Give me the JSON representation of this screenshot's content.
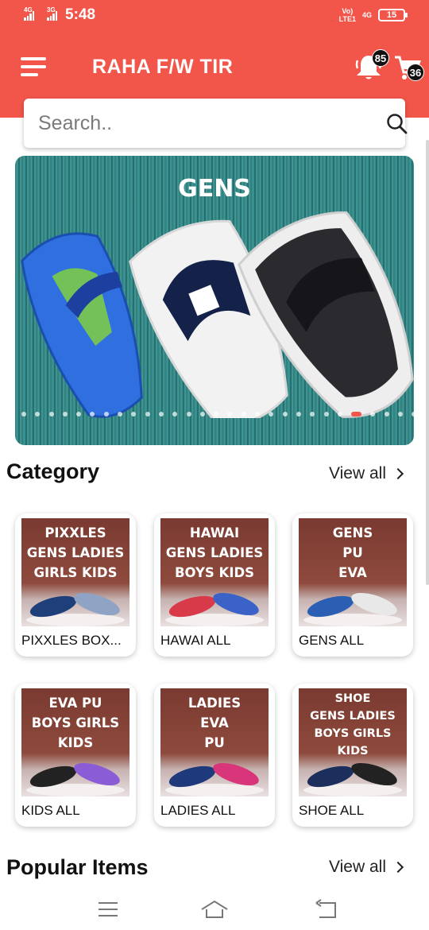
{
  "status_bar": {
    "sim1": "4G",
    "sim2": "3G",
    "time": "5:48",
    "volte_line1": "Vo)",
    "volte_line2": "LTE1",
    "network": "4G",
    "battery": "15"
  },
  "app_bar": {
    "title": "RAHA F/W TIR",
    "notification_count": "85",
    "cart_count": "36",
    "menu_icon": "hamburger-icon",
    "bell_icon": "bell-icon",
    "cart_icon": "cart-icon"
  },
  "search": {
    "placeholder": "Search..",
    "icon": "search-icon"
  },
  "banner": {
    "title": "GENS",
    "slide_count": 30,
    "active_slide": 24
  },
  "category_section": {
    "title": "Category",
    "view_all": "View all",
    "items": [
      {
        "image_text": "PIXXLES\nGENS LADIES\nGIRLS KIDS",
        "label": "PIXXLES BOX..."
      },
      {
        "image_text": "HAWAI\nGENS LADIES\nBOYS KIDS",
        "label": "HAWAI ALL"
      },
      {
        "image_text": "GENS\nPU\nEVA",
        "label": "GENS ALL"
      },
      {
        "image_text": "EVA PU\nBOYS GIRLS\nKIDS",
        "label": "KIDS ALL"
      },
      {
        "image_text": "LADIES\nEVA\nPU",
        "label": "LADIES ALL"
      },
      {
        "image_text": "SHOE\nGENS LADIES\nBOYS GIRLS\nKIDS",
        "label": "SHOE ALL"
      }
    ]
  },
  "popular_section": {
    "title": "Popular Items",
    "view_all": "View all"
  },
  "nav_bar": {
    "menu_icon": "recent-apps-icon",
    "home_icon": "home-icon",
    "back_icon": "back-icon"
  },
  "colors": {
    "accent": "#f2564a",
    "badge": "#111111",
    "card_bg": "#8e4a3c"
  }
}
